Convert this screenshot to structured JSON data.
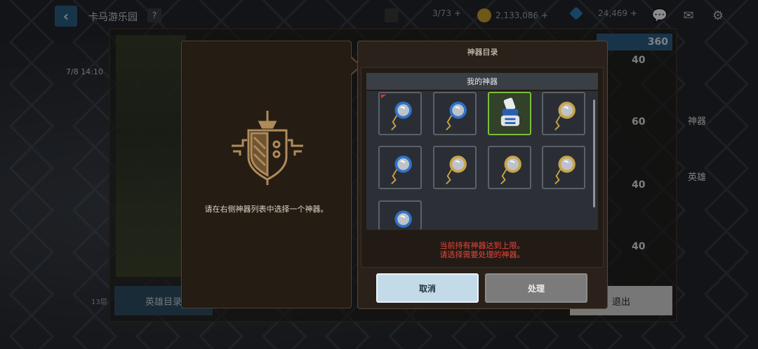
{
  "top_bar": {
    "title": "卡马游乐园",
    "help": "?",
    "resource_1": "3/73",
    "gold": "2,133,086",
    "gems": "24,469"
  },
  "background": {
    "date": "7/8 14:10",
    "floor": "13层",
    "counter": "360",
    "side_values": [
      "40",
      "60",
      "40",
      "40"
    ],
    "side_labels": {
      "artifact": "神器",
      "hero": "英雄"
    },
    "hero_list_button": "英雄目录",
    "exit_button": "退出"
  },
  "detail_panel": {
    "hint": "请在右侧神器列表中选择一个神器。"
  },
  "catalog_panel": {
    "title": "神器目录",
    "my_artifacts_header": "我的神器",
    "warning_line_1": "当前持有神器达到上限。",
    "warning_line_2": "请选择需要处理的神器。",
    "cancel_button": "取消",
    "process_button": "处理",
    "artifacts": [
      {
        "icon": "blue-monocle-icon",
        "selected": false
      },
      {
        "icon": "blue-monocle-icon",
        "selected": false
      },
      {
        "icon": "scroll-bundle-icon",
        "selected": true
      },
      {
        "icon": "gold-monocle-icon",
        "selected": false
      },
      {
        "icon": "blue-monocle-icon",
        "selected": false
      },
      {
        "icon": "gold-monocle-icon",
        "selected": false
      },
      {
        "icon": "gold-monocle-icon",
        "selected": false
      },
      {
        "icon": "gold-monocle-icon",
        "selected": false
      },
      {
        "icon": "blue-monocle-icon",
        "selected": false
      }
    ]
  },
  "colors": {
    "warning": "#e8453a",
    "selected_border": "#7bbd3c",
    "cancel_bg": "#c3dbe8",
    "process_bg": "#7b7b7b"
  }
}
